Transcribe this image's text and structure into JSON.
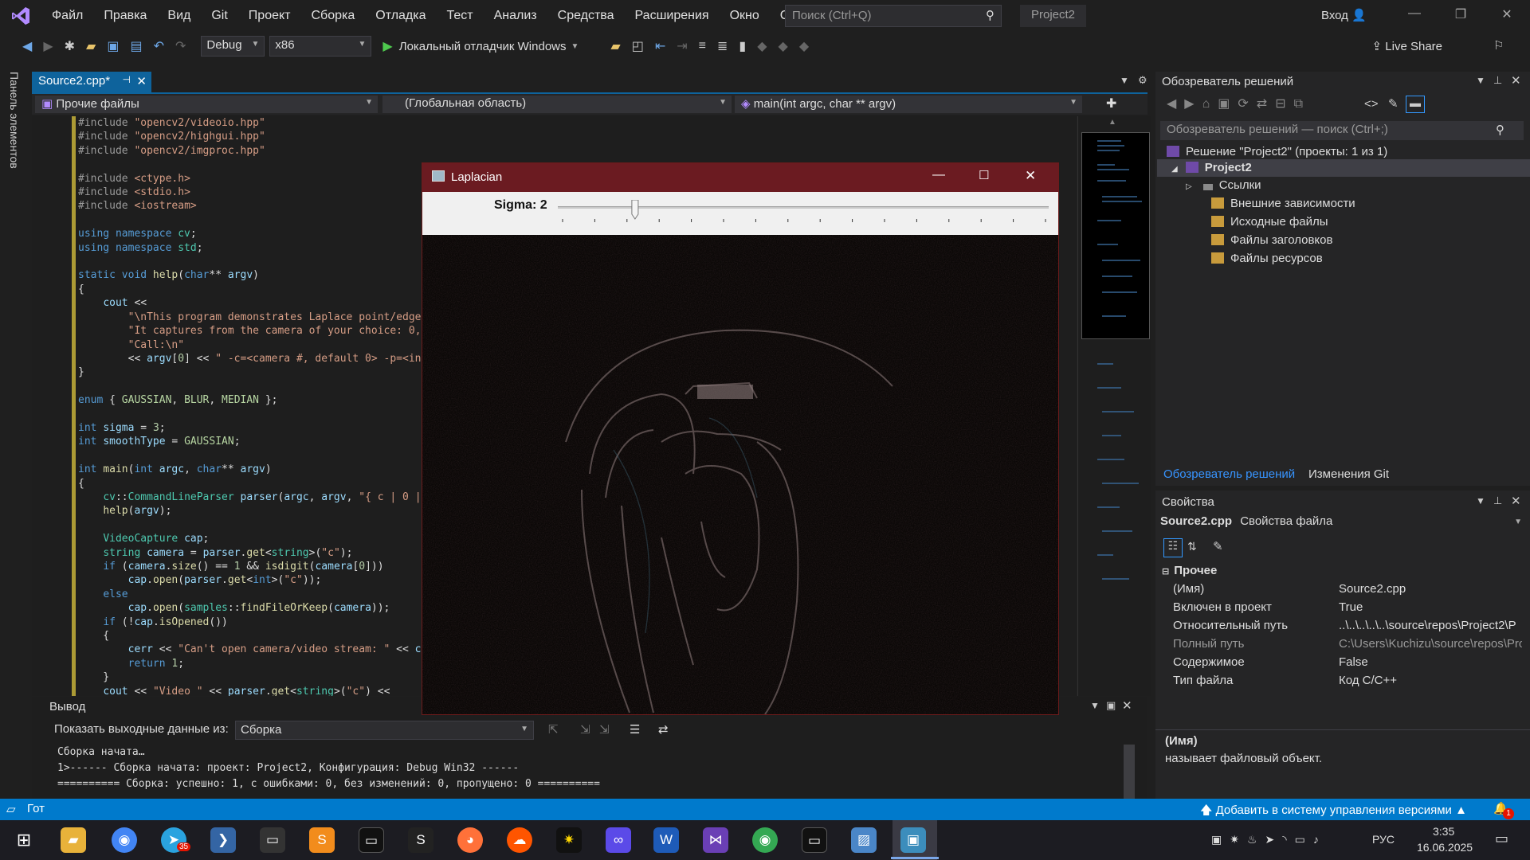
{
  "menubar": {
    "items": [
      "Файл",
      "Правка",
      "Вид",
      "Git",
      "Проект",
      "Сборка",
      "Отладка",
      "Тест",
      "Анализ",
      "Средства",
      "Расширения",
      "Окно",
      "Справка"
    ],
    "search_placeholder": "Поиск (Ctrl+Q)",
    "project_title": "Project2",
    "signin": "Вход"
  },
  "toolbar": {
    "config": "Debug",
    "platform": "x86",
    "run_label": "Локальный отладчик Windows",
    "live_share": "Live Share"
  },
  "left_rail": {
    "label": "Панель элементов"
  },
  "editor": {
    "tab_label": "Source2.cpp*",
    "nav_files": "Прочие файлы",
    "nav_scope": "(Глобальная область)",
    "nav_member": "main(int argc, char ** argv)"
  },
  "output": {
    "title": "Вывод",
    "show_label": "Показать выходные данные из:",
    "source": "Сборка",
    "lines": [
      "Сборка начата…",
      "1>------ Сборка начата: проект: Project2, Конфигурация: Debug Win32 ------",
      "========== Сборка: успешно: 1, с ошибками: 0, без изменений: 0, пропущено: 0 =========="
    ]
  },
  "solution_explorer": {
    "title": "Обозреватель решений",
    "search_placeholder": "Обозреватель решений — поиск (Ctrl+;)",
    "solution": "Решение \"Project2\" (проекты: 1 из 1)",
    "project": "Project2",
    "items": [
      "Ссылки",
      "Внешние зависимости",
      "Исходные файлы",
      "Файлы заголовков",
      "Файлы ресурсов"
    ],
    "tab_active": "Обозреватель решений",
    "tab_other": "Изменения Git"
  },
  "properties": {
    "title": "Свойства",
    "object": "Source2.cpp",
    "object_type": "Свойства файла",
    "category": "Прочее",
    "rows": [
      {
        "key": "(Имя)",
        "value": "Source2.cpp"
      },
      {
        "key": "Включен в проект",
        "value": "True"
      },
      {
        "key": "Относительный путь",
        "value": "..\\..\\..\\..\\..\\source\\repos\\Project2\\P"
      },
      {
        "key": "Полный путь",
        "value": "C:\\Users\\Kuchizu\\source\\repos\\Proj"
      },
      {
        "key": "Содержимое",
        "value": "False"
      },
      {
        "key": "Тип файла",
        "value": "Код C/C++"
      }
    ],
    "desc_title": "(Имя)",
    "desc_text": "называет файловый объект."
  },
  "laplacian": {
    "title": "Laplacian",
    "trackbar_label": "Sigma: 2",
    "sigma_value": 2,
    "sigma_fraction": 0.15
  },
  "statusbar": {
    "left": "Гот",
    "vcs": "Добавить в систему управления версиями",
    "notif_count": "1"
  },
  "taskbar": {
    "lang": "РУС",
    "time": "3:35",
    "date": "16.06.2025",
    "telegram_badge": "35"
  }
}
